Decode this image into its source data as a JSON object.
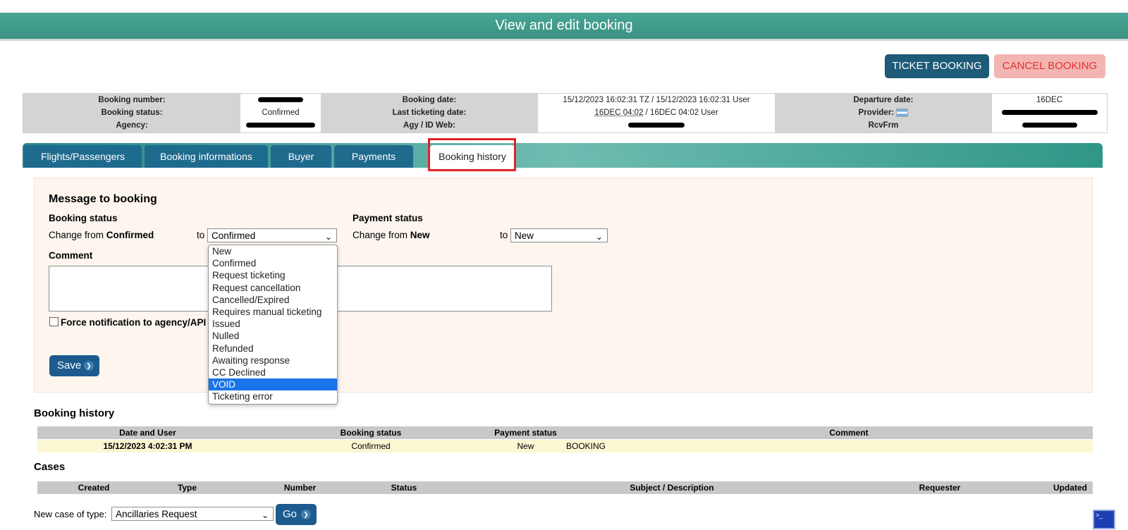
{
  "header": {
    "title": "View and edit booking"
  },
  "actions": {
    "ticket_label": "TICKET BOOKING",
    "cancel_label": "CANCEL BOOKING"
  },
  "summary": {
    "booking_number_label": "Booking number:",
    "booking_status_label": "Booking status:",
    "agency_label": "Agency:",
    "booking_status_value": "Confirmed",
    "booking_date_label": "Booking date:",
    "last_ticketing_label": "Last ticketing date:",
    "agy_label": "Agy / ID Web:",
    "booking_date_value": "15/12/2023 16:02:31 TZ / 15/12/2023 16:02:31 User",
    "last_ticketing_value_a": "16DEC 04:02",
    "last_ticketing_value_b": " / 16DEC 04:02 User",
    "departure_label": "Departure date:",
    "provider_label": "Provider:",
    "rcvfrm_label": "RcvFrm",
    "departure_value": "16DEC"
  },
  "tabs": [
    {
      "label": "Flights/Passengers"
    },
    {
      "label": "Booking informations"
    },
    {
      "label": "Buyer"
    },
    {
      "label": "Payments"
    },
    {
      "label": "Booking history"
    }
  ],
  "message": {
    "title": "Message to booking",
    "booking_status_heading": "Booking status",
    "change_from_text": "Change from ",
    "booking_current": "Confirmed",
    "to_text": "to",
    "booking_selected": "Confirmed",
    "payment_status_heading": "Payment status",
    "payment_current": "New",
    "payment_selected": "New",
    "comment_label": "Comment",
    "force_label": "Force notification to agency/API",
    "save_label": "Save"
  },
  "dropdown": {
    "options": [
      "New",
      "Confirmed",
      "Request ticketing",
      "Request cancellation",
      "Cancelled/Expired",
      "Requires manual ticketing",
      "Issued",
      "Nulled",
      "Refunded",
      "Awaiting response",
      "CC Declined",
      "VOID",
      "Ticketing error"
    ],
    "highlighted": "VOID"
  },
  "history": {
    "title": "Booking history",
    "headers": [
      "Date and User",
      "Booking status",
      "Payment status",
      "Comment"
    ],
    "rows": [
      [
        "15/12/2023 4:02:31 PM",
        "Confirmed",
        "New",
        "BOOKING"
      ]
    ]
  },
  "cases": {
    "title": "Cases",
    "headers": [
      "Created",
      "Type",
      "Number",
      "Status",
      "Subject / Description",
      "Requester",
      "Updated"
    ],
    "new_case_label": "New case of type:",
    "new_case_value": "Ancillaries Request",
    "go_label": "Go"
  },
  "colors": {
    "teal": "#3a9282",
    "tab_blue": "#1f6b8e",
    "ticket_btn": "#1d5b78",
    "cancel_btn": "#f3b5b2",
    "highlight": "#e02323",
    "selected_option": "#1a73e8"
  }
}
